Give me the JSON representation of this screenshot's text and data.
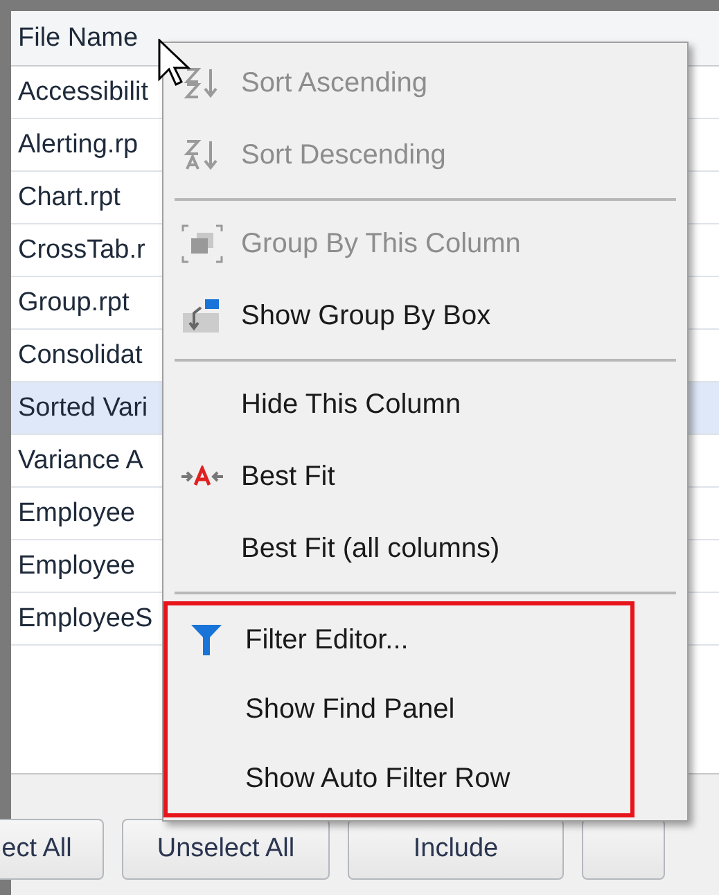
{
  "grid": {
    "column": "File Name",
    "rows": [
      {
        "text": "Accessibilit",
        "selected": false
      },
      {
        "text": "Alerting.rp",
        "selected": false
      },
      {
        "text": "Chart.rpt",
        "selected": false
      },
      {
        "text": "CrossTab.r",
        "selected": false
      },
      {
        "text": "Group.rpt",
        "selected": false
      },
      {
        "text": "Consolidat",
        "selected": false
      },
      {
        "text": "Sorted Vari",
        "selected": true
      },
      {
        "text": "Variance A",
        "selected": false
      },
      {
        "text": "Employee",
        "selected": false
      },
      {
        "text": "Employee",
        "selected": false
      },
      {
        "text": "EmployeeS",
        "selected": false
      }
    ]
  },
  "buttons": [
    {
      "label": "ect All"
    },
    {
      "label": "Unselect All"
    },
    {
      "label": "Include"
    }
  ],
  "menu": [
    {
      "kind": "item",
      "label": "Sort Ascending",
      "disabled": true,
      "highlighted": false
    },
    {
      "kind": "item",
      "label": "Sort Descending",
      "disabled": true,
      "highlighted": false
    },
    {
      "kind": "separator"
    },
    {
      "kind": "item",
      "label": "Group By This Column",
      "disabled": true,
      "highlighted": false
    },
    {
      "kind": "item",
      "label": "Show Group By Box",
      "disabled": false,
      "highlighted": false
    },
    {
      "kind": "separator"
    },
    {
      "kind": "item",
      "label": "Hide This Column",
      "disabled": false,
      "highlighted": false
    },
    {
      "kind": "item",
      "label": "Best Fit",
      "disabled": false,
      "highlighted": false
    },
    {
      "kind": "item",
      "label": "Best Fit (all columns)",
      "disabled": false,
      "highlighted": false
    },
    {
      "kind": "separator"
    },
    {
      "kind": "item",
      "label": "Filter Editor...",
      "disabled": false,
      "highlighted": true
    },
    {
      "kind": "item",
      "label": "Show Find Panel",
      "disabled": false,
      "highlighted": true
    },
    {
      "kind": "item",
      "label": "Show Auto Filter Row",
      "disabled": false,
      "highlighted": true
    }
  ]
}
